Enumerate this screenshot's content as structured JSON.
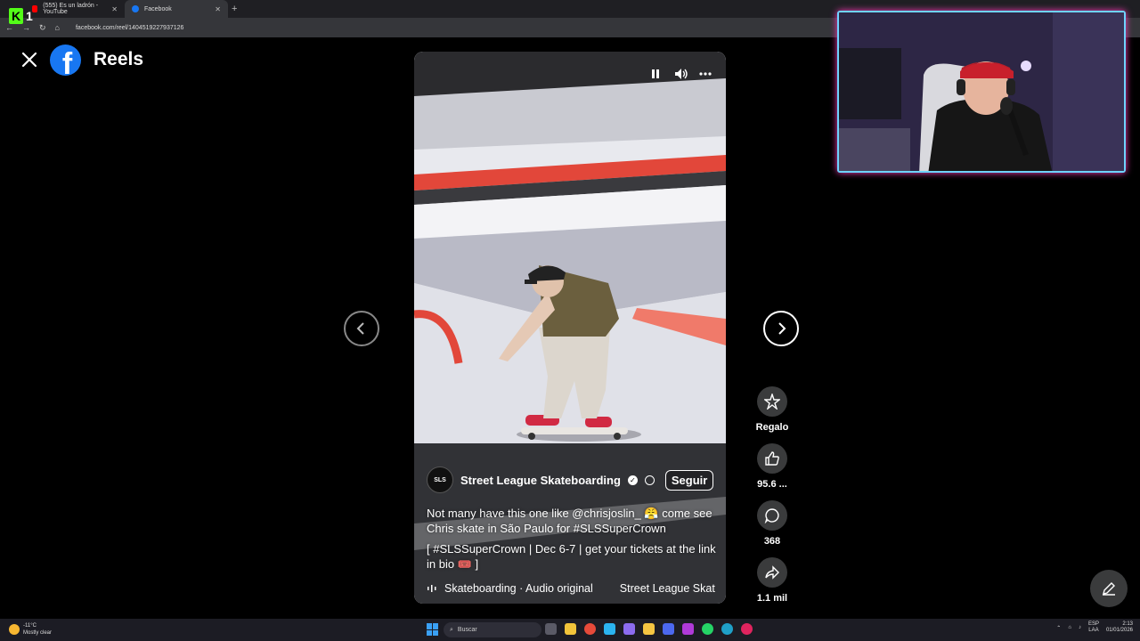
{
  "browser": {
    "tabs": [
      {
        "label": "(555) Es un ladrón - YouTube"
      },
      {
        "label": "Facebook"
      }
    ],
    "url": "facebook.com/reel/1404519227937126"
  },
  "kick": {
    "letter": "K",
    "number": "1"
  },
  "header": {
    "title": "Reels"
  },
  "reel": {
    "owner": "Street League Skateboarding",
    "avatar_text": "SLS",
    "follow_label": "Seguir",
    "caption_line1": "Not many have this one like @chrisjoslin_ 😤 come see Chris skate in São Paulo for #SLSSuperCrown",
    "caption_line2": "[ #SLSSuperCrown | Dec 6-7 | get your tickets at the link in bio 🎟️ ]",
    "audio": "Skateboarding · Audio original",
    "audio_alt": "Street League Skat"
  },
  "actions": {
    "gift_label": "Regalo",
    "like_label": "95.6 ...",
    "comment_label": "368",
    "share_label": "1.1 mil"
  },
  "taskbar": {
    "weather_temp": "-11°C",
    "weather_desc": "Mostly clear",
    "search_label": "Buscar",
    "lang_top": "ESP",
    "lang_bottom": "LAA",
    "time": "2:13",
    "date": "01/01/2026"
  },
  "colors": {
    "facebook_blue": "#1877f2",
    "kick_green": "#53fc18",
    "webcam_border": "#6fd3ff"
  }
}
